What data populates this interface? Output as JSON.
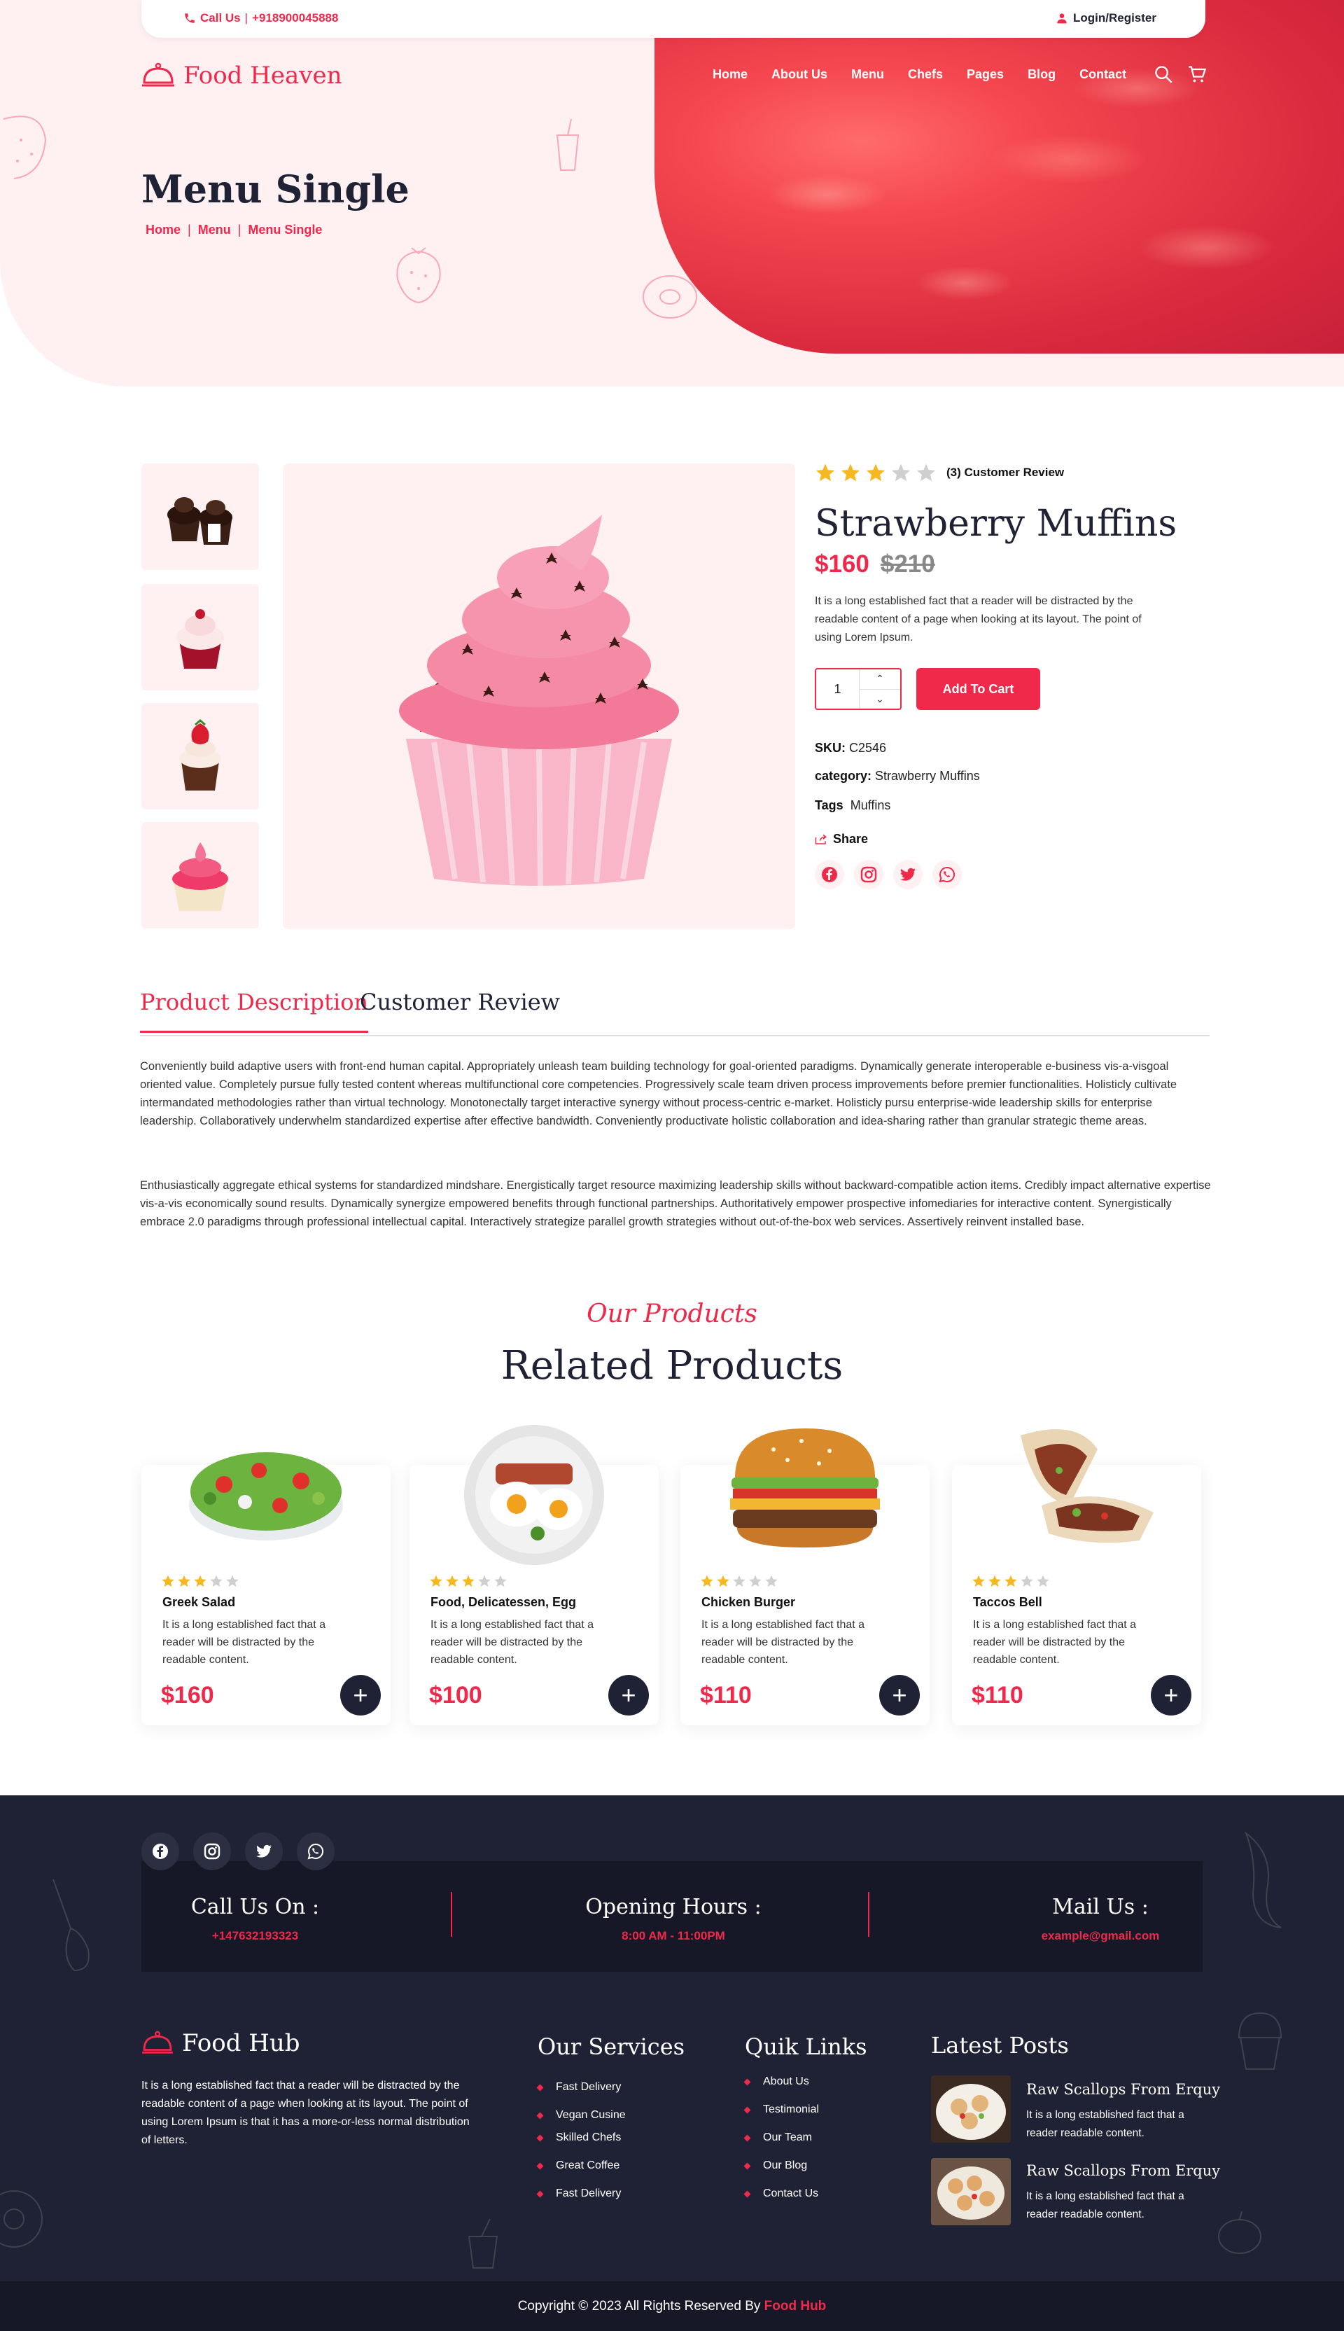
{
  "topbar": {
    "call_label": "Call Us",
    "phone": "+918900045888",
    "login": "Login/Register"
  },
  "brand": {
    "name": "Food Heaven"
  },
  "nav": {
    "items": [
      "Home",
      "About Us",
      "Menu",
      "Chefs",
      "Pages",
      "Blog",
      "Contact"
    ]
  },
  "hero": {
    "title": "Menu Single",
    "breadcrumb": [
      "Home",
      "Menu",
      "Menu Single"
    ]
  },
  "product": {
    "rating": 3,
    "rating_max": 5,
    "review_label": "(3) Customer Review",
    "name": "Strawberry Muffins",
    "price": "$160",
    "old_price": "$210",
    "description": "It is a long established fact that a reader will be distracted by the readable content of a page when looking at its layout. The point of using Lorem Ipsum.",
    "quantity": "1",
    "add_to_cart": "Add To Cart",
    "sku_label": "SKU:",
    "sku": "C2546",
    "category_label": "category:",
    "category": "Strawberry Muffins",
    "tags_label": "Tags",
    "tags": "Muffins",
    "share_label": "Share",
    "thumbnails": [
      "chocolate-cupcakes",
      "red-velvet-cupcake",
      "strawberry-cupcake",
      "pink-swirl-cupcake"
    ]
  },
  "tabs": {
    "description": "Product Description",
    "review": "Customer Review"
  },
  "description": {
    "p1": "Conveniently build adaptive users with front-end human capital. Appropriately unleash team building technology for goal-oriented paradigms. Dynamically generate interoperable e-business vis-a-visgoal oriented value. Completely pursue fully tested content whereas multifunctional core competencies. Progressively scale team driven process improvements before premier functionalities. Holisticly cultivate intermandated methodologies rather than virtual technology. Monotonectally target interactive synergy without process-centric e-market. Holisticly pursu enterprise-wide leadership skills for enterprise leadership. Collaboratively underwhelm standardized expertise after effective bandwidth. Conveniently productivate holistic collaboration and idea-sharing rather than granular strategic theme areas.",
    "p2": "Enthusiastically aggregate ethical systems for standardized mindshare. Energistically target resource maximizing leadership skills without backward-compatible action items. Credibly impact alternative expertise vis-a-vis economically sound results. Dynamically synergize empowered benefits through functional partnerships. Authoritatively empower prospective infomediaries for interactive content. Synergistically embrace 2.0 paradigms through professional intellectual capital. Interactively strategize parallel growth strategies without out-of-the-box web services. Assertively reinvent installed base."
  },
  "related": {
    "kicker": "Our Products",
    "title": "Related Products",
    "items": [
      {
        "name": "Greek Salad",
        "text": "It is a long established fact that a reader will be distracted by the readable content.",
        "price": "$160",
        "rating": 3
      },
      {
        "name": "Food, Delicatessen, Egg",
        "text": "It is a long established fact that a reader will be distracted by the readable content.",
        "price": "$100",
        "rating": 3
      },
      {
        "name": "Chicken Burger",
        "text": "It is a long established fact that a reader will be distracted by the readable content.",
        "price": "$110",
        "rating": 2
      },
      {
        "name": "Taccos Bell",
        "text": "It is a long established fact that a reader will be distracted by the readable content.",
        "price": "$110",
        "rating": 3
      }
    ]
  },
  "footer": {
    "call_title": "Call Us On :",
    "call_value": "+147632193323",
    "hours_title": "Opening Hours :",
    "hours_value": "8:00 AM - 11:00PM",
    "mail_title": "Mail Us :",
    "mail_value": "example@gmail.com",
    "brand": "Food Hub",
    "about": "It is a long established fact that a reader will be distracted by the readable content of a page when looking at its layout. The point of using Lorem Ipsum is that it has a more-or-less normal distribution of letters.",
    "services_title": "Our Services",
    "services": [
      "Fast Delivery",
      "Vegan Cusine",
      "Skilled Chefs",
      "Great Coffee",
      "Fast Delivery"
    ],
    "links_title": "Quik Links",
    "links": [
      "About Us",
      "Testimonial",
      "Our Team",
      "Our Blog",
      "Contact Us"
    ],
    "posts_title": "Latest Posts",
    "posts": [
      {
        "title": "Raw Scallops From Erquy",
        "text": "It is a long established fact that a reader readable content."
      },
      {
        "title": "Raw Scallops From Erquy",
        "text": "It is a long established fact that a reader readable content."
      }
    ],
    "copyright": "Copyright © 2023 All Rights Reserved By",
    "copyright_brand": "Food Hub"
  },
  "colors": {
    "accent": "#f0284a",
    "dark": "#1f2235",
    "hero_bg": "#fff0f2"
  }
}
